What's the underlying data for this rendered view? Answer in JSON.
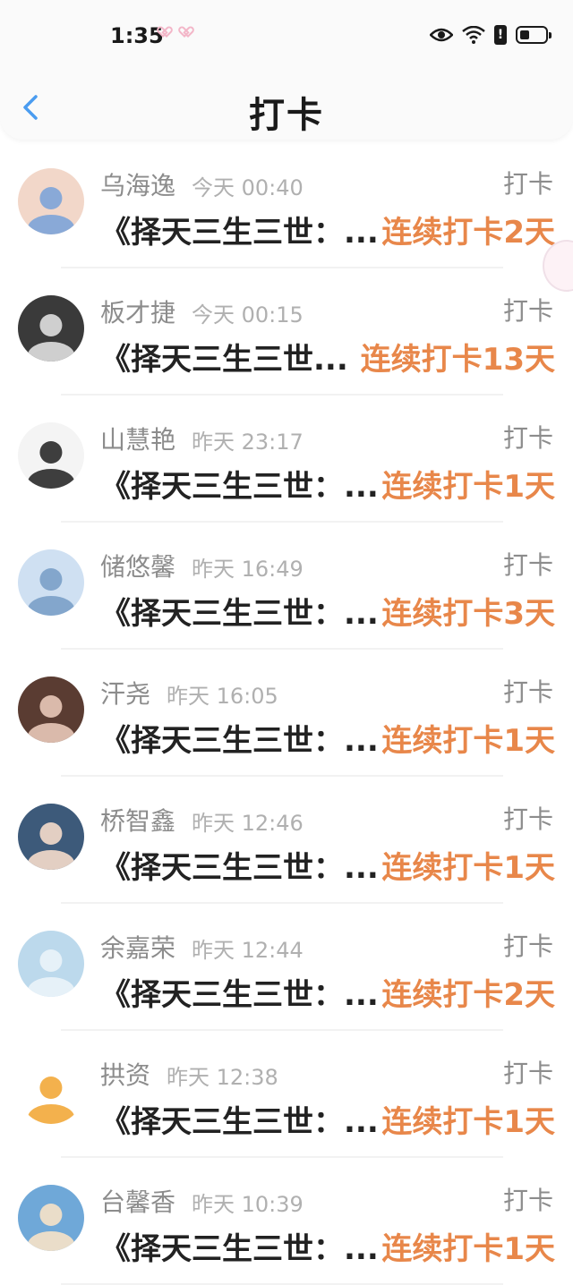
{
  "status_bar": {
    "time": "1:35"
  },
  "header": {
    "title": "打卡"
  },
  "colors": {
    "accent": "#e8874a",
    "back_icon": "#4a9cf0"
  },
  "items": [
    {
      "name": "乌海逸",
      "time": "今天 00:40",
      "action": "打卡",
      "title": "《择天三生三世：...",
      "streak": "连续打卡2天",
      "avatar_bg": "#f2d7c9",
      "avatar_fg": "#7da4d8"
    },
    {
      "name": "板才捷",
      "time": "今天 00:15",
      "action": "打卡",
      "title": "《择天三生三世...",
      "streak": "连续打卡13天",
      "avatar_bg": "#3a3a3a",
      "avatar_fg": "#e0e0e0"
    },
    {
      "name": "山慧艳",
      "time": "昨天 23:17",
      "action": "打卡",
      "title": "《择天三生三世：...",
      "streak": "连续打卡1天",
      "avatar_bg": "#f4f4f4",
      "avatar_fg": "#2a2a2a"
    },
    {
      "name": "储悠馨",
      "time": "昨天 16:49",
      "action": "打卡",
      "title": "《择天三生三世：...",
      "streak": "连续打卡3天",
      "avatar_bg": "#cfe0f2",
      "avatar_fg": "#7aa0c8"
    },
    {
      "name": "汗尧",
      "time": "昨天 16:05",
      "action": "打卡",
      "title": "《择天三生三世：...",
      "streak": "连续打卡1天",
      "avatar_bg": "#5a3c32",
      "avatar_fg": "#e8c8b8"
    },
    {
      "name": "桥智鑫",
      "time": "昨天 12:46",
      "action": "打卡",
      "title": "《择天三生三世：...",
      "streak": "连续打卡1天",
      "avatar_bg": "#3d5a7a",
      "avatar_fg": "#f5dccb"
    },
    {
      "name": "余嘉荣",
      "time": "昨天 12:44",
      "action": "打卡",
      "title": "《择天三生三世：...",
      "streak": "连续打卡2天",
      "avatar_bg": "#bcd9ec",
      "avatar_fg": "#eaf3f9"
    },
    {
      "name": "拱资",
      "time": "昨天 12:38",
      "action": "打卡",
      "title": "《择天三生三世：...",
      "streak": "连续打卡1天",
      "avatar_bg": "#ffffff",
      "avatar_fg": "#f2a83a"
    },
    {
      "name": "台馨香",
      "time": "昨天 10:39",
      "action": "打卡",
      "title": "《择天三生三世：...",
      "streak": "连续打卡1天",
      "avatar_bg": "#6fa8d8",
      "avatar_fg": "#f7e2c8"
    }
  ]
}
